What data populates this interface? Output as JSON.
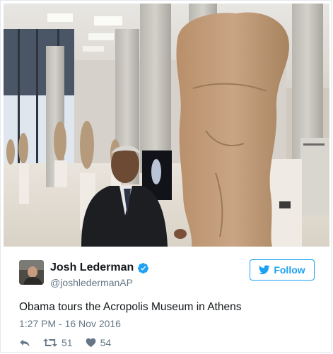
{
  "tweet": {
    "author": {
      "display_name": "Josh Lederman",
      "handle": "@joshledermanAP",
      "verified": true
    },
    "follow_label": "Follow",
    "text": "Obama tours the Acropolis Museum in Athens",
    "timestamp": "1:27 PM - 16 Nov 2016",
    "retweets": "51",
    "likes": "54"
  },
  "icons": {
    "verified": "verified-badge-icon",
    "follow": "twitter-bird-icon",
    "reply": "reply-icon",
    "retweet": "retweet-icon",
    "like": "heart-icon"
  },
  "colors": {
    "accent": "#1da1f2",
    "text_primary": "#14171a",
    "text_secondary": "#657786",
    "border": "#e1e8ed"
  }
}
